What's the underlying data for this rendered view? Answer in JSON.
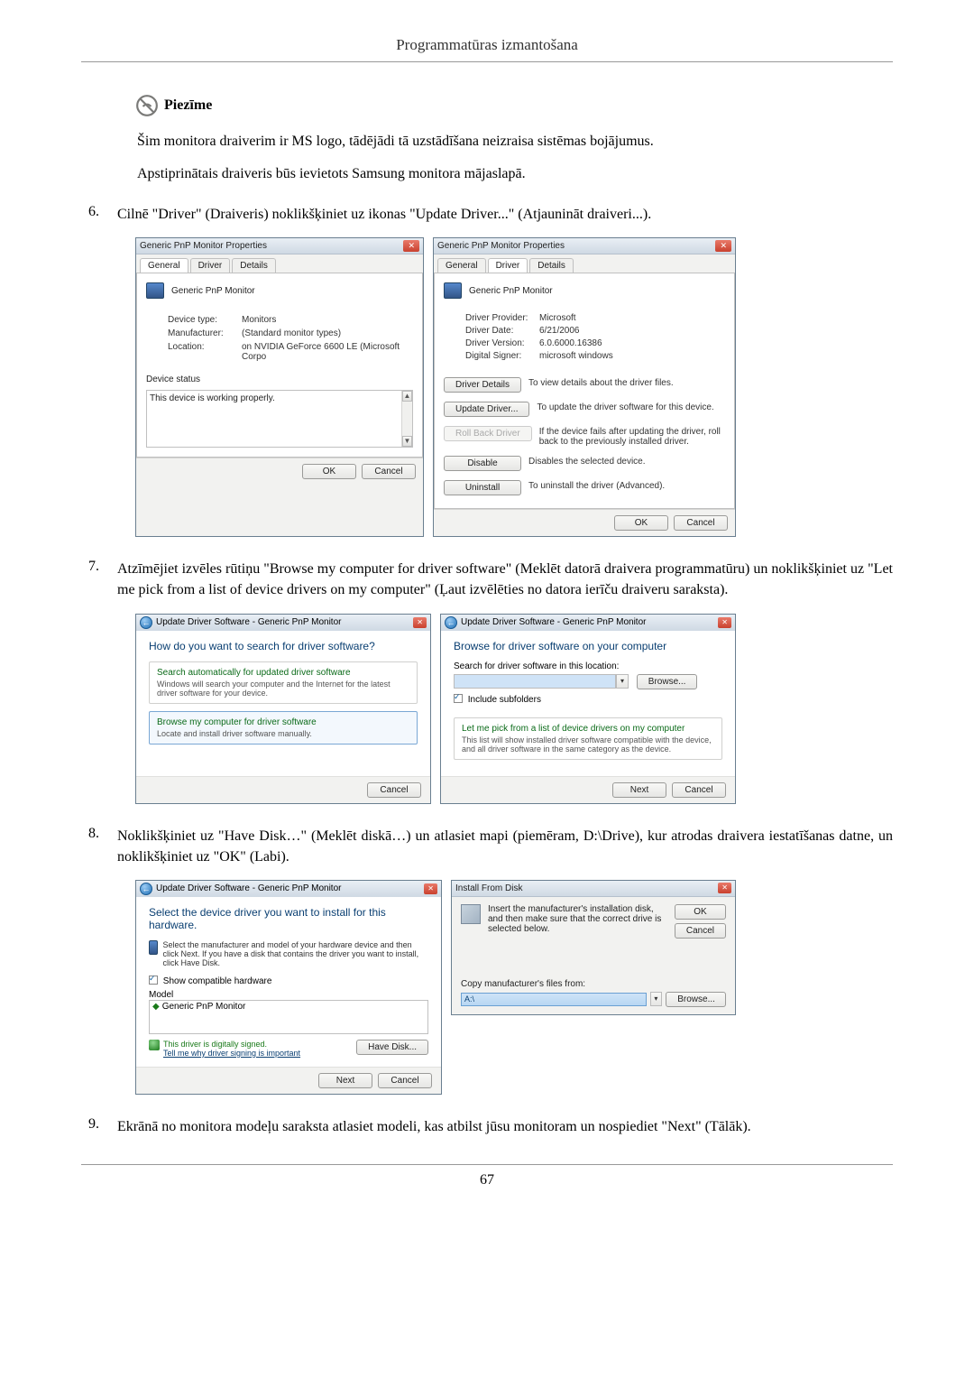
{
  "header": "Programmatūras izmantošana",
  "note": {
    "label": "Piezīme",
    "line1": "Šim monitora draiverim ir MS logo, tādējādi tā uzstādīšana neizraisa sistēmas bojājumus.",
    "line2": "Apstiprinātais draiveris būs ievietots Samsung monitora mājaslapā."
  },
  "step6": {
    "num": "6.",
    "text": "Cilnē \"Driver\" (Draiveris) noklikšķiniet uz ikonas \"Update Driver...\" (Atjaunināt draiveri...)."
  },
  "dlg1": {
    "title": "Generic PnP Monitor Properties",
    "tabs": {
      "general": "General",
      "driver": "Driver",
      "details": "Details"
    },
    "monitor_name": "Generic PnP Monitor",
    "fields": {
      "device_type_label": "Device type:",
      "device_type_val": "Monitors",
      "manufacturer_label": "Manufacturer:",
      "manufacturer_val": "(Standard monitor types)",
      "location_label": "Location:",
      "location_val": "on NVIDIA GeForce 6600 LE (Microsoft Corpo"
    },
    "status_label": "Device status",
    "status_text": "This device is working properly.",
    "ok": "OK",
    "cancel": "Cancel"
  },
  "dlg2": {
    "title": "Generic PnP Monitor Properties",
    "tabs": {
      "general": "General",
      "driver": "Driver",
      "details": "Details"
    },
    "monitor_name": "Generic PnP Monitor",
    "fields": {
      "provider_label": "Driver Provider:",
      "provider_val": "Microsoft",
      "date_label": "Driver Date:",
      "date_val": "6/21/2006",
      "version_label": "Driver Version:",
      "version_val": "6.0.6000.16386",
      "signer_label": "Digital Signer:",
      "signer_val": "microsoft windows"
    },
    "btns": {
      "details": "Driver Details",
      "details_desc": "To view details about the driver files.",
      "update": "Update Driver...",
      "update_desc": "To update the driver software for this device.",
      "rollback": "Roll Back Driver",
      "rollback_desc": "If the device fails after updating the driver, roll back to the previously installed driver.",
      "disable": "Disable",
      "disable_desc": "Disables the selected device.",
      "uninstall": "Uninstall",
      "uninstall_desc": "To uninstall the driver (Advanced)."
    },
    "ok": "OK",
    "cancel": "Cancel"
  },
  "step7": {
    "num": "7.",
    "text": "Atzīmējiet izvēles rūtiņu \"Browse my computer for driver software\" (Meklēt datorā draivera programmatūru) un noklikšķiniet uz \"Let me pick from a list of device drivers on my computer\" (Ļaut izvēlēties no datora ierīču draiveru saraksta)."
  },
  "wiz1": {
    "title": "Update Driver Software - Generic PnP Monitor",
    "heading": "How do you want to search for driver software?",
    "opt1_title": "Search automatically for updated driver software",
    "opt1_sub": "Windows will search your computer and the Internet for the latest driver software for your device.",
    "opt2_title": "Browse my computer for driver software",
    "opt2_sub": "Locate and install driver software manually.",
    "cancel": "Cancel"
  },
  "wiz2": {
    "title": "Update Driver Software - Generic PnP Monitor",
    "heading": "Browse for driver software on your computer",
    "search_label": "Search for driver software in this location:",
    "browse": "Browse...",
    "include": "Include subfolders",
    "opt_title": "Let me pick from a list of device drivers on my computer",
    "opt_sub": "This list will show installed driver software compatible with the device, and all driver software in the same category as the device.",
    "next": "Next",
    "cancel": "Cancel"
  },
  "step8": {
    "num": "8.",
    "text": "Noklikšķiniet uz \"Have Disk…\" (Meklēt diskā…) un atlasiet mapi (piemēram, D:\\Drive), kur atrodas draivera iestatīšanas datne, un noklikšķiniet uz \"OK\" (Labi)."
  },
  "wiz3": {
    "title": "Update Driver Software - Generic PnP Monitor",
    "heading": "Select the device driver you want to install for this hardware.",
    "sub": "Select the manufacturer and model of your hardware device and then click Next. If you have a disk that contains the driver you want to install, click Have Disk.",
    "show_compat": "Show compatible hardware",
    "model_header": "Model",
    "model_item": "Generic PnP Monitor",
    "sign_text": "This driver is digitally signed.",
    "sign_link": "Tell me why driver signing is important",
    "have_disk": "Have Disk...",
    "next": "Next",
    "cancel": "Cancel"
  },
  "dlg_disk": {
    "title": "Install From Disk",
    "instruction": "Insert the manufacturer's installation disk, and then make sure that the correct drive is selected below.",
    "ok": "OK",
    "cancel": "Cancel",
    "copy_label": "Copy manufacturer's files from:",
    "copy_value": "A:\\",
    "browse": "Browse..."
  },
  "step9": {
    "num": "9.",
    "text": "Ekrānā no monitora modeļu saraksta atlasiet modeli, kas atbilst jūsu monitoram un nospiediet \"Next\" (Tālāk)."
  },
  "page_num": "67"
}
